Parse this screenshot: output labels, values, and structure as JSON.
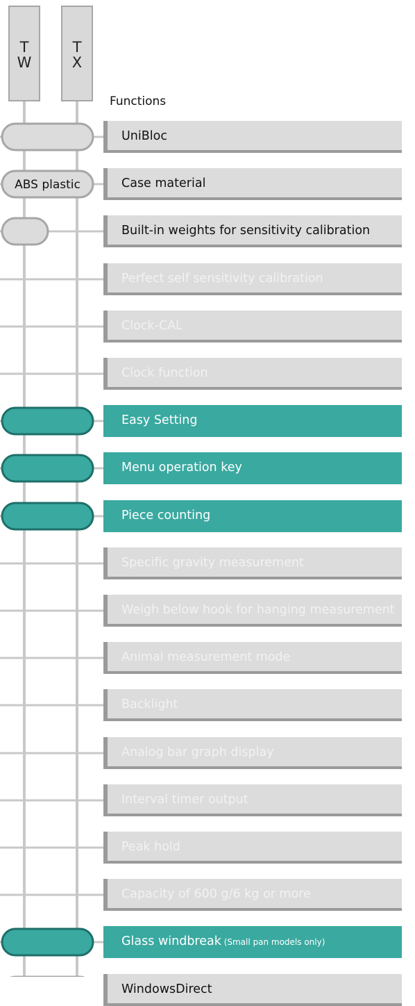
{
  "columns": [
    {
      "id": "tw",
      "line1": "T",
      "line2": "W"
    },
    {
      "id": "tx",
      "line1": "T",
      "line2": "X"
    }
  ],
  "functions_heading": "Functions",
  "colors": {
    "teal": "#3aa9a0",
    "gray_box": "#dcdcdc",
    "gray_border": "#9a9a9a",
    "line": "#c8c8c8"
  },
  "rows": [
    {
      "label": "UniBloc",
      "note": "",
      "state": "on",
      "tw": "pill",
      "tx": "pill",
      "pill_text": ""
    },
    {
      "label": "Case material",
      "note": "",
      "state": "on",
      "tw": "pill",
      "tx": "pill",
      "pill_text": "ABS plastic"
    },
    {
      "label": "Built-in weights for sensitivity calibration",
      "note": "",
      "state": "on",
      "tw": "pill",
      "tx": "none",
      "pill_text": ""
    },
    {
      "label": "Perfect self sensitivity calibration",
      "note": "",
      "state": "off",
      "tw": "none",
      "tx": "none",
      "pill_text": ""
    },
    {
      "label": "Clock-CAL",
      "note": "",
      "state": "off",
      "tw": "none",
      "tx": "none",
      "pill_text": ""
    },
    {
      "label": "Clock function",
      "note": "",
      "state": "off",
      "tw": "none",
      "tx": "none",
      "pill_text": ""
    },
    {
      "label": "Easy Setting",
      "note": "",
      "state": "hl",
      "tw": "teal",
      "tx": "teal",
      "pill_text": ""
    },
    {
      "label": "Menu operation key",
      "note": "",
      "state": "hl",
      "tw": "teal",
      "tx": "teal",
      "pill_text": ""
    },
    {
      "label": "Piece counting",
      "note": "",
      "state": "hl",
      "tw": "teal",
      "tx": "teal",
      "pill_text": ""
    },
    {
      "label": "Specific gravity measurement",
      "note": "",
      "state": "off",
      "tw": "none",
      "tx": "none",
      "pill_text": ""
    },
    {
      "label": "Weigh below hook for hanging measurement",
      "note": "",
      "state": "off",
      "tw": "none",
      "tx": "none",
      "pill_text": ""
    },
    {
      "label": "Animal measurement mode",
      "note": "",
      "state": "off",
      "tw": "none",
      "tx": "none",
      "pill_text": ""
    },
    {
      "label": "Backlight",
      "note": "",
      "state": "off",
      "tw": "none",
      "tx": "none",
      "pill_text": ""
    },
    {
      "label": "Analog bar graph display",
      "note": "",
      "state": "off",
      "tw": "none",
      "tx": "none",
      "pill_text": ""
    },
    {
      "label": "Interval timer output",
      "note": "",
      "state": "off",
      "tw": "none",
      "tx": "none",
      "pill_text": ""
    },
    {
      "label": "Peak hold",
      "note": "",
      "state": "off",
      "tw": "none",
      "tx": "none",
      "pill_text": ""
    },
    {
      "label": "Capacity of 600 g/6 kg or more",
      "note": "",
      "state": "off",
      "tw": "none",
      "tx": "none",
      "pill_text": ""
    },
    {
      "label": "Glass windbreak",
      "note": "(Small pan models only)",
      "state": "hl",
      "tw": "teal",
      "tx": "teal",
      "pill_text": ""
    },
    {
      "label": "WindowsDirect",
      "note": "",
      "state": "on",
      "tw": "pill",
      "tx": "pill",
      "pill_text": ""
    }
  ]
}
